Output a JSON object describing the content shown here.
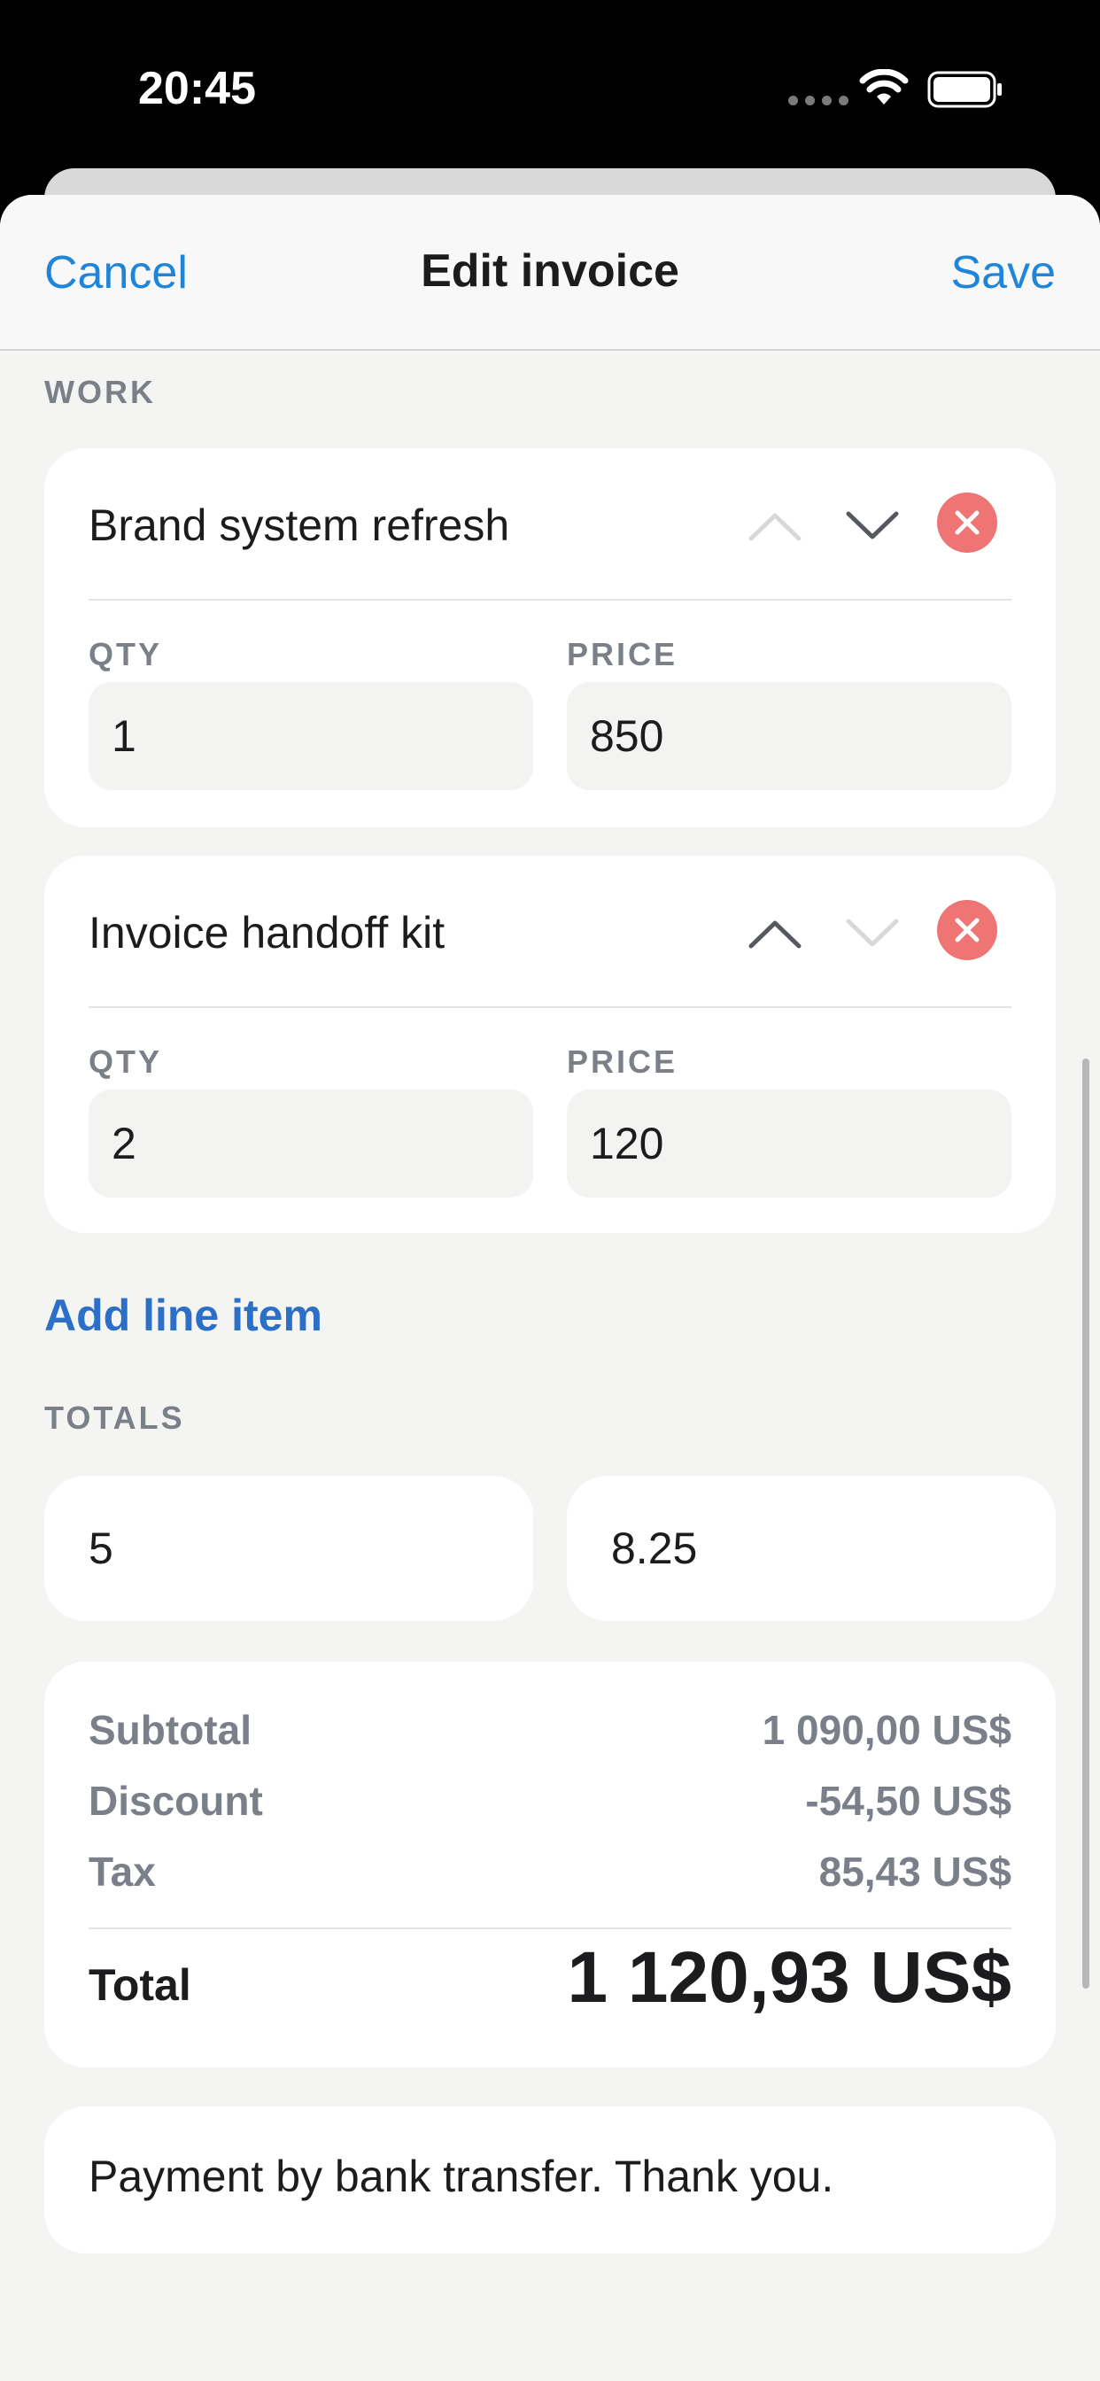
{
  "status_bar": {
    "time": "20:45"
  },
  "nav": {
    "cancel_label": "Cancel",
    "title": "Edit invoice",
    "save_label": "Save"
  },
  "work": {
    "section_label": "WORK",
    "items": [
      {
        "title": "Brand system refresh",
        "qty_label": "QTY",
        "qty": "1",
        "price_label": "PRICE",
        "price": "850",
        "move_up_enabled": false,
        "move_down_enabled": true
      },
      {
        "title": "Invoice handoff kit",
        "qty_label": "QTY",
        "qty": "2",
        "price_label": "PRICE",
        "price": "120",
        "move_up_enabled": true,
        "move_down_enabled": false
      }
    ],
    "add_label": "Add line item"
  },
  "totals": {
    "section_label": "TOTALS",
    "discount_input": "5",
    "tax_input": "8.25",
    "subtotal_label": "Subtotal",
    "subtotal": "1 090,00 US$",
    "discount_label": "Discount",
    "discount": "-54,50 US$",
    "tax_label": "Tax",
    "tax": "85,43 US$",
    "total_label": "Total",
    "total": "1 120,93 US$"
  },
  "notes": {
    "text": "Payment by bank transfer. Thank you."
  },
  "colors": {
    "accent": "#1f85d9",
    "link": "#2b6fc6",
    "remove": "#ef7474",
    "background": "#f4f4f3"
  }
}
